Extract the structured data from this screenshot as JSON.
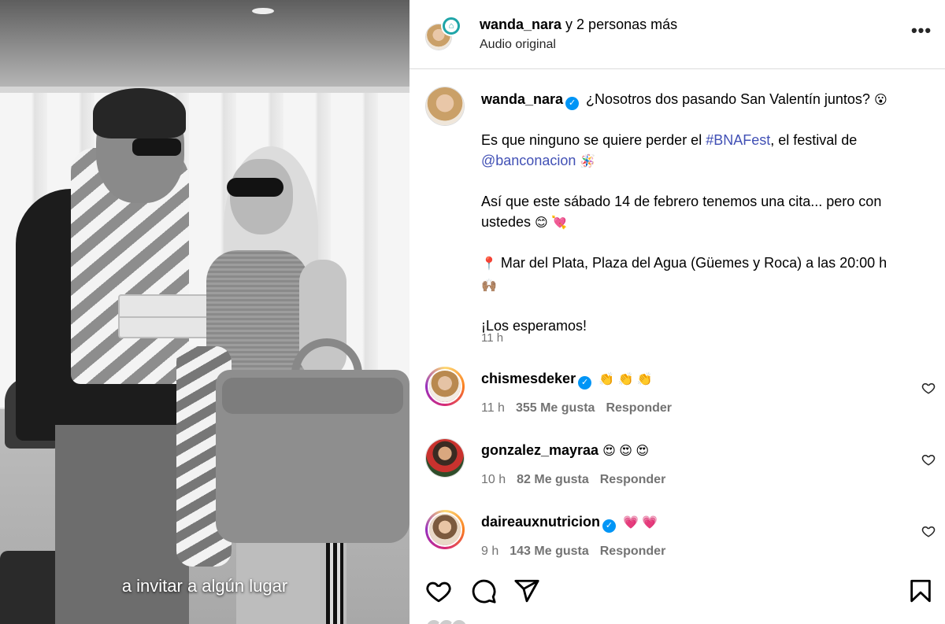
{
  "video": {
    "subtitle": "a invitar a algún lugar"
  },
  "header": {
    "username": "wanda_nara",
    "collab_suffix": " y 2 personas más",
    "audio": "Audio original",
    "more_label": "•••"
  },
  "caption": {
    "username": "wanda_nara",
    "line1": " ¿Nosotros dos pasando San Valentín juntos? ",
    "line1_emoji": "😮",
    "p2_a": "Es que ninguno se quiere perder el ",
    "p2_hashtag": "#BNAFest",
    "p2_b": ", el festival de",
    "p2_mention": "@banconacion",
    "p2_emoji": "🪅",
    "p3": "Así que este sábado 14 de febrero tenemos una cita... pero con ustedes ",
    "p3_emoji": "😊 💘",
    "p4_pin": "📍",
    "p4": " Mar del Plata, Plaza del Agua (Güemes y Roca) a las 20:00 h ",
    "p4_emoji": "🙌🏽",
    "p5": "¡Los esperamos!",
    "time": "11 h"
  },
  "comments": [
    {
      "username": "chismesdeker",
      "verified": true,
      "text": "👏 👏 👏",
      "time": "11 h",
      "likes": "355 Me gusta",
      "reply": "Responder"
    },
    {
      "username": "gonzalez_mayraa",
      "verified": false,
      "text": "😍 😍 😍",
      "time": "10 h",
      "likes": "82 Me gusta",
      "reply": "Responder"
    },
    {
      "username": "daireauxnutricion",
      "verified": true,
      "text": "💗 💗",
      "time": "9 h",
      "likes": "143 Me gusta",
      "reply": "Responder"
    }
  ],
  "colors": {
    "link": "#4150b5",
    "verified": "#0095f6",
    "meta": "#737373"
  },
  "icons": {
    "like": "heart-icon",
    "comment": "comment-icon",
    "share": "send-icon",
    "save": "bookmark-icon"
  }
}
